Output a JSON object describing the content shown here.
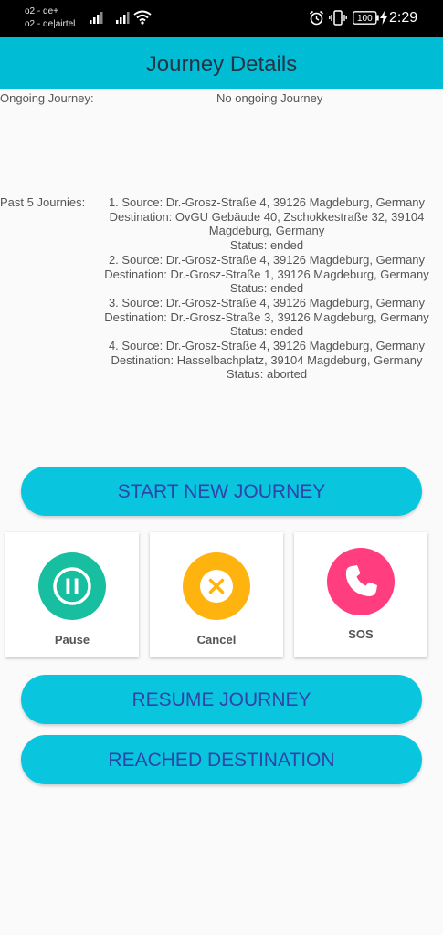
{
  "status_bar": {
    "carrier_1": "o2 - de+",
    "carrier_2": "o2 - de|airtel",
    "battery": "100",
    "time": "2:29",
    "icons": [
      "signal-icon",
      "signal-icon",
      "wifi-icon",
      "alarm-icon",
      "vibrate-icon",
      "battery-icon",
      "charging-icon"
    ]
  },
  "header": {
    "title": "Journey Details"
  },
  "ongoing": {
    "label": "Ongoing Journey:",
    "value": "No ongoing Journey"
  },
  "past": {
    "label": "Past 5 Journies:",
    "journeys": [
      {
        "source": "1. Source: Dr.-Grosz-Straße 4, 39126 Magdeburg, Germany",
        "destination": "Destination: OvGU Gebäude 40, Zschokkestraße 32, 39104 Magdeburg, Germany",
        "status": "Status: ended"
      },
      {
        "source": "2. Source: Dr.-Grosz-Straße 4, 39126 Magdeburg, Germany",
        "destination": "Destination: Dr.-Grosz-Straße 1, 39126 Magdeburg, Germany",
        "status": "Status: ended"
      },
      {
        "source": "3. Source: Dr.-Grosz-Straße 4, 39126 Magdeburg, Germany",
        "destination": "Destination: Dr.-Grosz-Straße 3, 39126 Magdeburg, Germany",
        "status": "Status: ended"
      },
      {
        "source": "4. Source: Dr.-Grosz-Straße 4, 39126 Magdeburg, Germany",
        "destination": "Destination: Hasselbachplatz, 39104 Magdeburg, Germany",
        "status": "Status: aborted"
      }
    ]
  },
  "buttons": {
    "start": "START NEW JOURNEY",
    "resume": "RESUME JOURNEY",
    "reached": "REACHED DESTINATION"
  },
  "actions": [
    {
      "label": "Pause",
      "icon": "pause-icon",
      "color": "#17bfa0"
    },
    {
      "label": "Cancel",
      "icon": "close-icon",
      "color": "#ffb30f"
    },
    {
      "label": "SOS",
      "icon": "phone-icon",
      "color": "#ff3d7f"
    }
  ],
  "colors": {
    "primary": "#00bcd4",
    "button": "#09c6de",
    "button_text": "#3043a8",
    "title_text": "#263545"
  }
}
